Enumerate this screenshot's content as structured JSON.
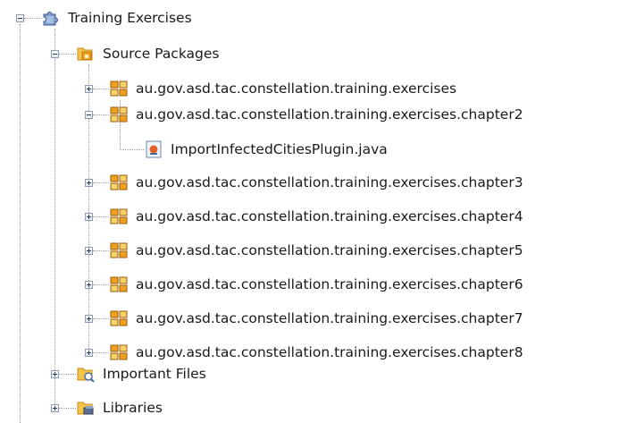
{
  "project": {
    "name": "Training Exercises",
    "icon": "project-puzzle-icon",
    "expanded": true
  },
  "folders": [
    {
      "label": "Source Packages",
      "icon": "source-packages-folder-icon",
      "expanded": true,
      "packages": [
        {
          "label": "au.gov.asd.tac.constellation.training.exercises",
          "expanded": false,
          "files": []
        },
        {
          "label": "au.gov.asd.tac.constellation.training.exercises.chapter2",
          "expanded": true,
          "files": [
            {
              "label": "ImportInfectedCitiesPlugin.java",
              "icon": "java-file-icon"
            }
          ]
        },
        {
          "label": "au.gov.asd.tac.constellation.training.exercises.chapter3",
          "expanded": false,
          "files": []
        },
        {
          "label": "au.gov.asd.tac.constellation.training.exercises.chapter4",
          "expanded": false,
          "files": []
        },
        {
          "label": "au.gov.asd.tac.constellation.training.exercises.chapter5",
          "expanded": false,
          "files": []
        },
        {
          "label": "au.gov.asd.tac.constellation.training.exercises.chapter6",
          "expanded": false,
          "files": []
        },
        {
          "label": "au.gov.asd.tac.constellation.training.exercises.chapter7",
          "expanded": false,
          "files": []
        },
        {
          "label": "au.gov.asd.tac.constellation.training.exercises.chapter8",
          "expanded": false,
          "files": []
        }
      ]
    },
    {
      "label": "Important Files",
      "icon": "important-files-folder-icon",
      "expanded": false
    },
    {
      "label": "Libraries",
      "icon": "libraries-folder-icon",
      "expanded": false
    }
  ],
  "colors": {
    "package_orange": "#f0a020",
    "package_gold": "#f6d36a",
    "folder_yellow": "#f3c64a"
  }
}
